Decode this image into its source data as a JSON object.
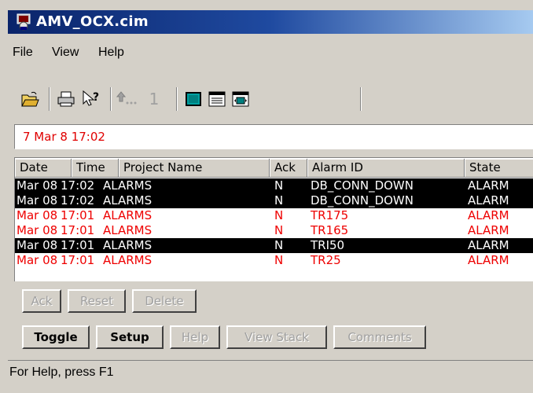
{
  "window": {
    "title": "AMV_OCX.cim"
  },
  "menu": {
    "items": [
      "File",
      "View",
      "Help"
    ]
  },
  "toolbar": {
    "buttons": [
      {
        "icon": "open-folder-icon"
      },
      {
        "icon": "print-icon"
      },
      {
        "icon": "context-help-icon"
      },
      {
        "icon": "page-up-icon"
      },
      {
        "icon": "page-number-icon",
        "label": "1"
      },
      {
        "icon": "single-window-icon"
      },
      {
        "icon": "list-view-icon"
      },
      {
        "icon": "details-window-icon"
      }
    ]
  },
  "date_display": "7 Mar 8 17:02",
  "alarm_list": {
    "columns": [
      "Date",
      "Time",
      "Project Name",
      "Ack",
      "Alarm ID",
      "State"
    ],
    "rows": [
      {
        "date": "Mar 08",
        "time": "17:02",
        "project": "ALARMS",
        "ack": "N",
        "alarm_id": "DB_CONN_DOWN",
        "state": "ALARM",
        "style": "sel"
      },
      {
        "date": "Mar 08",
        "time": "17:02",
        "project": "ALARMS",
        "ack": "N",
        "alarm_id": "DB_CONN_DOWN",
        "state": "ALARM",
        "style": "sel"
      },
      {
        "date": "Mar 08",
        "time": "17:01",
        "project": "ALARMS",
        "ack": "N",
        "alarm_id": "TR175",
        "state": "ALARM",
        "style": "red"
      },
      {
        "date": "Mar 08",
        "time": "17:01",
        "project": "ALARMS",
        "ack": "N",
        "alarm_id": "TR165",
        "state": "ALARM",
        "style": "red"
      },
      {
        "date": "Mar 08",
        "time": "17:01",
        "project": "ALARMS",
        "ack": "N",
        "alarm_id": "TRI50",
        "state": "ALARM",
        "style": "sel"
      },
      {
        "date": "Mar 08",
        "time": "17:01",
        "project": "ALARMS",
        "ack": "N",
        "alarm_id": "TR25",
        "state": "ALARM",
        "style": "red"
      }
    ]
  },
  "buttons": {
    "ack": "Ack",
    "reset": "Reset",
    "delete": "Delete",
    "toggle": "Toggle",
    "setup": "Setup",
    "help": "Help",
    "view_stack": "View Stack",
    "comments": "Comments"
  },
  "status_bar": {
    "text": "For Help, press F1"
  },
  "colors": {
    "alarm_red": "#ee0000",
    "title_blue": "#0a246a",
    "selected_row": "#000000"
  }
}
